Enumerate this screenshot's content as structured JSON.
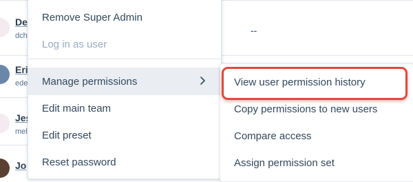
{
  "users": [
    {
      "name": "De",
      "email": "dch",
      "avatar_color": "#f4eaf0"
    },
    {
      "name": "Eri",
      "email": "ede",
      "avatar_color": "#6b86a8"
    },
    {
      "name": "Jes",
      "email": "mel",
      "avatar_color": "#f4eaf0"
    },
    {
      "name": "Jo",
      "email": "",
      "avatar_color": "#5a4030"
    }
  ],
  "table": {
    "empty_value": "--"
  },
  "context_menu": {
    "items": [
      {
        "label": "Remove Super Admin"
      },
      {
        "label": "Log in as user",
        "disabled": true
      },
      {
        "label": "Manage permissions",
        "has_submenu": true,
        "active": true
      },
      {
        "label": "Edit main team"
      },
      {
        "label": "Edit preset"
      },
      {
        "label": "Reset password"
      }
    ]
  },
  "submenu": {
    "items": [
      {
        "label": "View user permission history",
        "highlighted": true
      },
      {
        "label": "Copy permissions to new users"
      },
      {
        "label": "Compare access"
      },
      {
        "label": "Assign permission set"
      }
    ]
  },
  "colors": {
    "highlight_border": "#e2473b",
    "active_item_bg": "#eaeef3",
    "text": "#33475b",
    "disabled_text": "#99acc2"
  }
}
